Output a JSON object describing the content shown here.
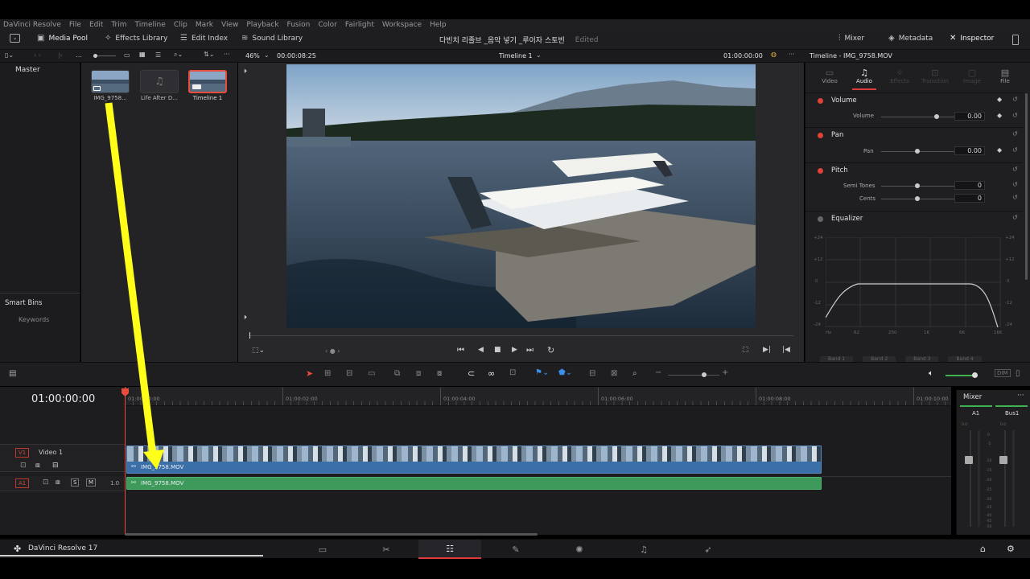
{
  "menu": [
    "DaVinci Resolve",
    "File",
    "Edit",
    "Trim",
    "Timeline",
    "Clip",
    "Mark",
    "View",
    "Playback",
    "Fusion",
    "Color",
    "Fairlight",
    "Workspace",
    "Help"
  ],
  "toolbar": {
    "media_pool": "Media Pool",
    "effects_library": "Effects Library",
    "edit_index": "Edit Index",
    "sound_library": "Sound Library",
    "project_title": "다빈치 리졸브 _음악 넣기 _루이자 스토빈",
    "project_status": "Edited",
    "mixer": "Mixer",
    "metadata": "Metadata",
    "inspector": "Inspector"
  },
  "subbar": {
    "zoom": "46%",
    "source_timecode": "00:00:08:25",
    "timeline_name": "Timeline 1",
    "record_timecode": "01:00:00:00",
    "inspector_title": "Timeline - IMG_9758.MOV"
  },
  "bins": {
    "master": "Master",
    "smart_bins": "Smart Bins",
    "keywords": "Keywords"
  },
  "media_pool_items": [
    {
      "label": "IMG_9758...",
      "kind": "video"
    },
    {
      "label": "Life After D...",
      "kind": "audio"
    },
    {
      "label": "Timeline 1",
      "kind": "timeline",
      "selected": true
    }
  ],
  "inspector": {
    "tabs": [
      {
        "label": "Video",
        "icon": "film-icon",
        "active": false
      },
      {
        "label": "Audio",
        "icon": "music-note-icon",
        "active": true
      },
      {
        "label": "Effects",
        "icon": "wand-icon",
        "active": false
      },
      {
        "label": "Transition",
        "icon": "transition-icon",
        "active": false
      },
      {
        "label": "Image",
        "icon": "image-icon",
        "active": false
      },
      {
        "label": "File",
        "icon": "file-icon",
        "active": false
      }
    ],
    "volume": {
      "title": "Volume",
      "param": "Volume",
      "value": "0.00",
      "level": 0.75
    },
    "pan": {
      "title": "Pan",
      "param": "Pan",
      "value": "0.00",
      "level": 0.5
    },
    "pitch": {
      "title": "Pitch",
      "semi_label": "Semi Tones",
      "semi_value": "0",
      "cents_label": "Cents",
      "cents_value": "0"
    },
    "equalizer": {
      "title": "Equalizer",
      "y_labels": [
        "+24",
        "+12",
        "0",
        "-12",
        "-24"
      ],
      "x_labels": [
        "Hz",
        "62",
        "250",
        "1K",
        "6K",
        "16K"
      ],
      "bands": [
        "Band 1",
        "Band 2",
        "Band 3",
        "Band 4"
      ]
    }
  },
  "timeline": {
    "timecode": "01:00:00:00",
    "ruler_labels": [
      "01:00:00:00",
      "01:00:02:00",
      "01:00:04:00",
      "01:00:06:00",
      "01:00:08:00",
      "01:00:10:00"
    ],
    "video_track": {
      "badge": "V1",
      "name": "Video 1",
      "clip": "IMG_9758.MOV"
    },
    "audio_track": {
      "badge": "A1",
      "level": "1.0",
      "clip": "IMG_9758.MOV",
      "s": "S",
      "m": "M"
    }
  },
  "mixer": {
    "title": "Mixer",
    "channels": [
      "A1",
      "Bus1"
    ],
    "scale": [
      "0.0",
      "0",
      "-5",
      "-10",
      "-15",
      "-20",
      "-25",
      "-30",
      "-35",
      "-40",
      "-45",
      "-50"
    ]
  },
  "bottom": {
    "app_name": "DaVinci Resolve 17",
    "pages": [
      {
        "name": "media",
        "icon": "media-page-icon",
        "active": false
      },
      {
        "name": "cut",
        "icon": "cut-page-icon",
        "active": false
      },
      {
        "name": "edit",
        "icon": "edit-page-icon",
        "active": true
      },
      {
        "name": "fusion",
        "icon": "fusion-page-icon",
        "active": false
      },
      {
        "name": "color",
        "icon": "color-page-icon",
        "active": false
      },
      {
        "name": "fairlight",
        "icon": "fairlight-page-icon",
        "active": false
      },
      {
        "name": "deliver",
        "icon": "deliver-page-icon",
        "active": false
      }
    ]
  },
  "colors": {
    "accent_red": "#dc3c3c",
    "video_clip": "#3a6fa8",
    "audio_clip": "#3e9a5a",
    "annotation_arrow": "#ffff1a"
  }
}
